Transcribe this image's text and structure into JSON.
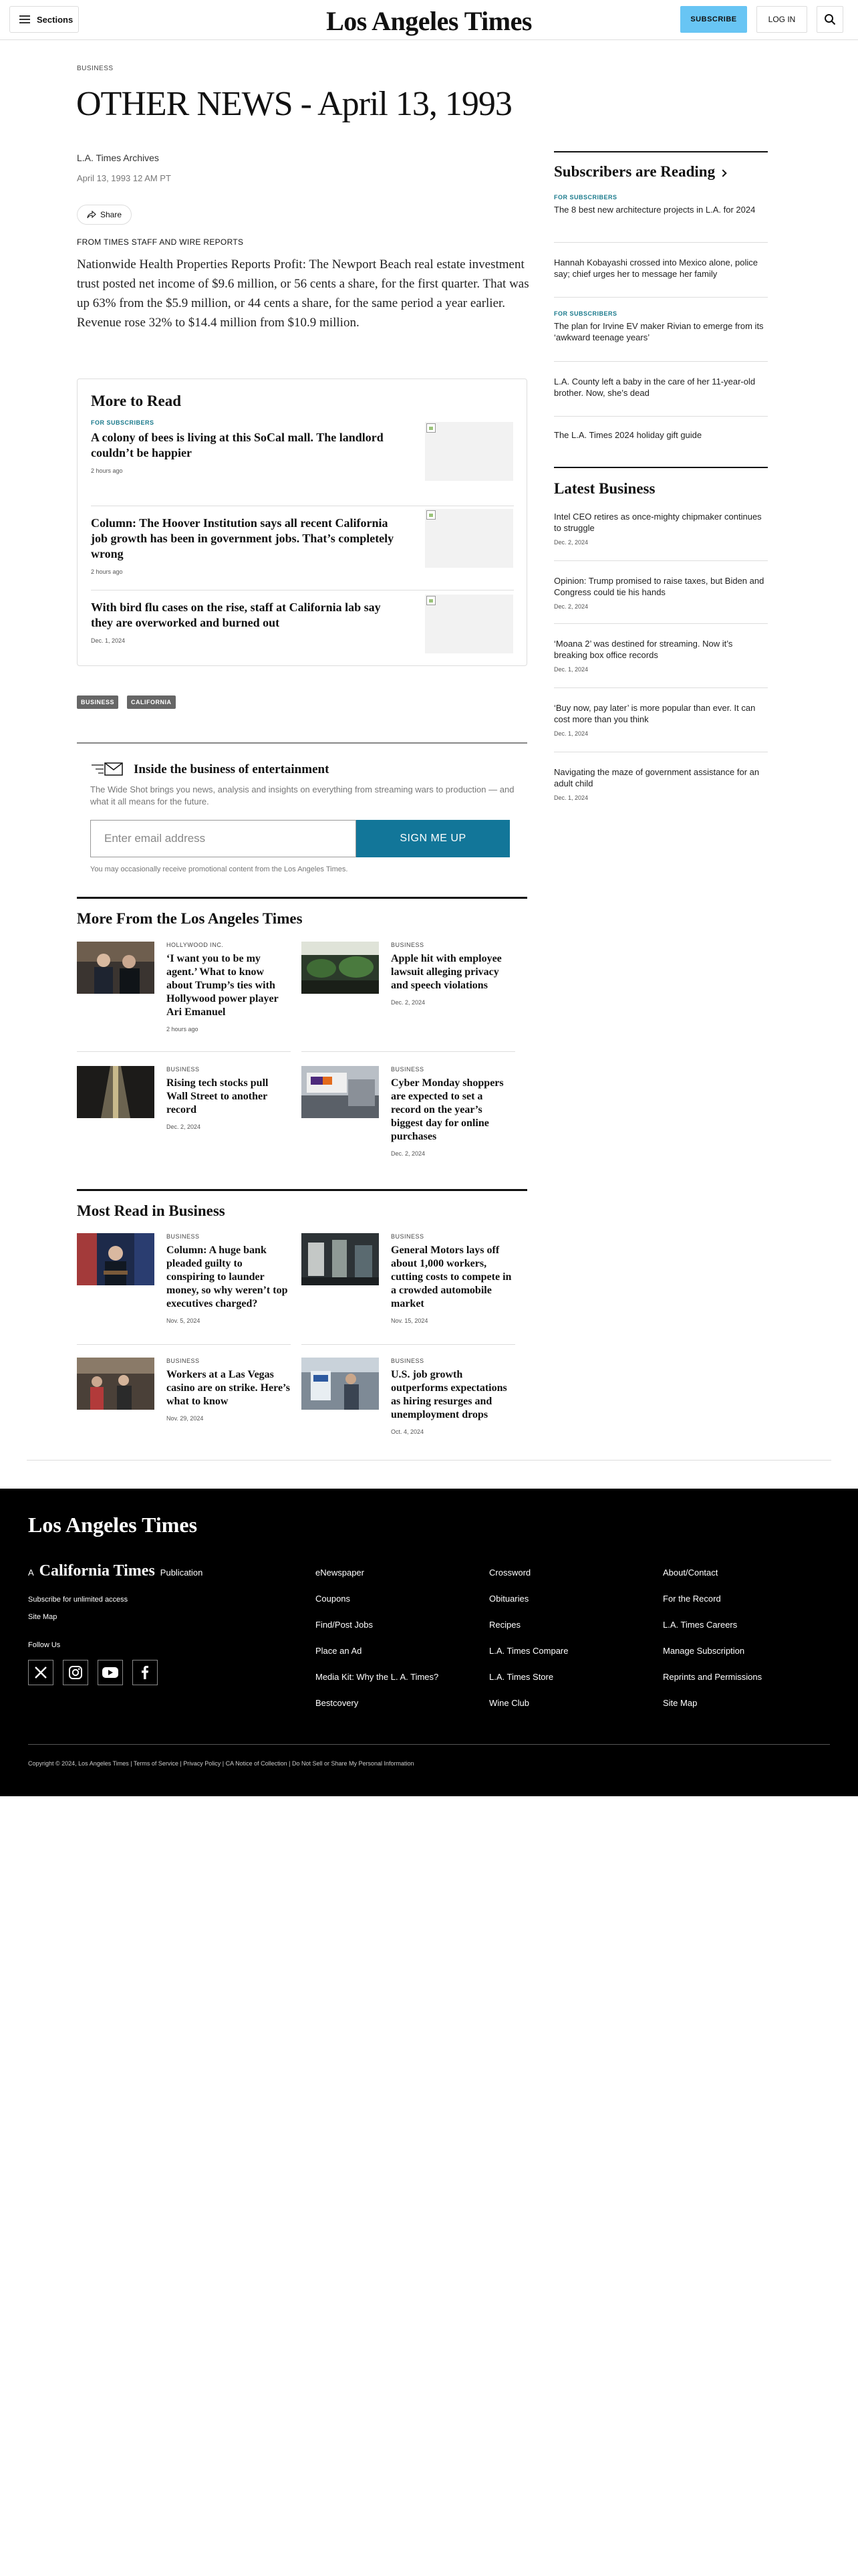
{
  "header": {
    "sections_label": "Sections",
    "logo": "Los Angeles Times",
    "subscribe_label": "SUBSCRIBE",
    "login_label": "LOG IN"
  },
  "article": {
    "kicker": "BUSINESS",
    "headline": "OTHER NEWS - April 13, 1993",
    "byline": "L.A. Times Archives",
    "date": "April 13, 1993 12 AM PT",
    "share_label": "Share",
    "source": "FROM TIMES STAFF AND WIRE REPORTS",
    "body": "Nationwide Health Properties Reports Profit: The Newport Beach real estate investment trust posted net income of $9.6 million, or 56 cents a share, for the first quarter. That was up 63% from the $5.9 million, or 44 cents a share, for the same period a year earlier. Revenue rose 32% to $14.4 million from $10.9 million.",
    "tags": [
      "BUSINESS",
      "CALIFORNIA"
    ]
  },
  "more_to_read": {
    "title": "More to Read",
    "items": [
      {
        "tag": "FOR SUBSCRIBERS",
        "headline": "A colony of bees is living at this SoCal mall. The landlord couldn’t be happier",
        "time": "2 hours ago"
      },
      {
        "tag": "",
        "headline": "Column: The Hoover Institution says all recent California job growth has been in government jobs. That’s completely wrong",
        "time": "2 hours ago"
      },
      {
        "tag": "",
        "headline": "With bird flu cases on the rise, staff at California lab say they are overworked and burned out",
        "time": "Dec. 1, 2024"
      }
    ]
  },
  "newsletter": {
    "title": "Inside the business of entertainment",
    "description": "The Wide Shot brings you news, analysis and insights on everything from streaming wars to production — and what it all means for the future.",
    "email_placeholder": "Enter email address",
    "button_label": "SIGN ME UP",
    "note": "You may occasionally receive promotional content from the Los Angeles Times."
  },
  "more_from": {
    "title": "More From the Los Angeles Times",
    "cards": [
      {
        "tag": "HOLLYWOOD INC.",
        "headline": "‘I want you to be my agent.’ What to know about Trump’s ties with Hollywood power player Ari Emanuel",
        "date": "2 hours ago"
      },
      {
        "tag": "BUSINESS",
        "headline": "Apple hit with employee lawsuit alleging privacy and speech violations",
        "date": "Dec. 2, 2024"
      },
      {
        "tag": "BUSINESS",
        "headline": "Rising tech stocks pull Wall Street to another record",
        "date": "Dec. 2, 2024"
      },
      {
        "tag": "BUSINESS",
        "headline": "Cyber Monday shoppers are expected to set a record on the year’s biggest day for online purchases",
        "date": "Dec. 2, 2024"
      }
    ]
  },
  "most_read": {
    "title": "Most Read in Business",
    "cards": [
      {
        "tag": "BUSINESS",
        "headline": "Column: A huge bank pleaded guilty to conspiring to launder money, so why weren’t top executives charged?",
        "date": "Nov. 5, 2024"
      },
      {
        "tag": "BUSINESS",
        "headline": "General Motors lays off about 1,000 workers, cutting costs to compete in a crowded automobile market",
        "date": "Nov. 15, 2024"
      },
      {
        "tag": "BUSINESS",
        "headline": "Workers at a Las Vegas casino are on strike. Here’s what to know",
        "date": "Nov. 29, 2024"
      },
      {
        "tag": "BUSINESS",
        "headline": "U.S. job growth outperforms expectations as hiring resurges and unemployment drops",
        "date": "Oct. 4, 2024"
      }
    ]
  },
  "subscribers_reading": {
    "title": "Subscribers are Reading",
    "items": [
      {
        "tag": "FOR SUBSCRIBERS",
        "text": "The 8 best new architecture projects in L.A. for 2024"
      },
      {
        "tag": "",
        "text": "Hannah Kobayashi crossed into Mexico alone, police say; chief urges her to message her family"
      },
      {
        "tag": "FOR SUBSCRIBERS",
        "text": "The plan for Irvine EV maker Rivian to emerge from its ‘awkward teenage years’"
      },
      {
        "tag": "",
        "text": "L.A. County left a baby in the care of her 11-year-old brother. Now, she’s dead"
      },
      {
        "tag": "",
        "text": "The L.A. Times 2024 holiday gift guide"
      }
    ]
  },
  "latest_business": {
    "title": "Latest Business",
    "items": [
      {
        "text": "Intel CEO retires as once-mighty chipmaker continues to struggle",
        "date": "Dec. 2, 2024"
      },
      {
        "text": "Opinion: Trump promised to raise taxes, but Biden and Congress could tie his hands",
        "date": "Dec. 2, 2024"
      },
      {
        "text": "‘Moana 2’ was destined for streaming. Now it’s breaking box office records",
        "date": "Dec. 1, 2024"
      },
      {
        "text": "‘Buy now, pay later’ is more popular than ever. It can cost more than you think",
        "date": "Dec. 1, 2024"
      },
      {
        "text": "Navigating the maze of government assistance for an adult child",
        "date": "Dec. 1, 2024"
      }
    ]
  },
  "footer": {
    "logo": "Los Angeles Times",
    "pub_a": "A",
    "pub_brand": "California Times",
    "pub_suffix": "Publication",
    "subscribe_link": "Subscribe for unlimited access",
    "site_map": "Site Map",
    "follow_us": "Follow Us",
    "col1": [
      "eNewspaper",
      "Coupons",
      "Find/Post Jobs",
      "Place an Ad",
      "Media Kit: Why the L. A. Times?",
      "Bestcovery"
    ],
    "col2": [
      "Crossword",
      "Obituaries",
      "Recipes",
      "L.A. Times Compare",
      "L.A. Times Store",
      "Wine Club"
    ],
    "col3": [
      "About/Contact",
      "For the Record",
      "L.A. Times Careers",
      "Manage Subscription",
      "Reprints and Permissions",
      "Site Map"
    ],
    "copyright": "Copyright © 2024, Los Angeles Times | Terms of Service | Privacy Policy | CA Notice of Collection | Do Not Sell or Share My Personal Information"
  },
  "icons": {
    "menu": "hamburger-icon",
    "search": "search-icon",
    "share": "share-icon",
    "newsletter": "envelope-icon",
    "social": [
      "x-icon",
      "instagram-icon",
      "youtube-icon",
      "facebook-icon"
    ]
  }
}
